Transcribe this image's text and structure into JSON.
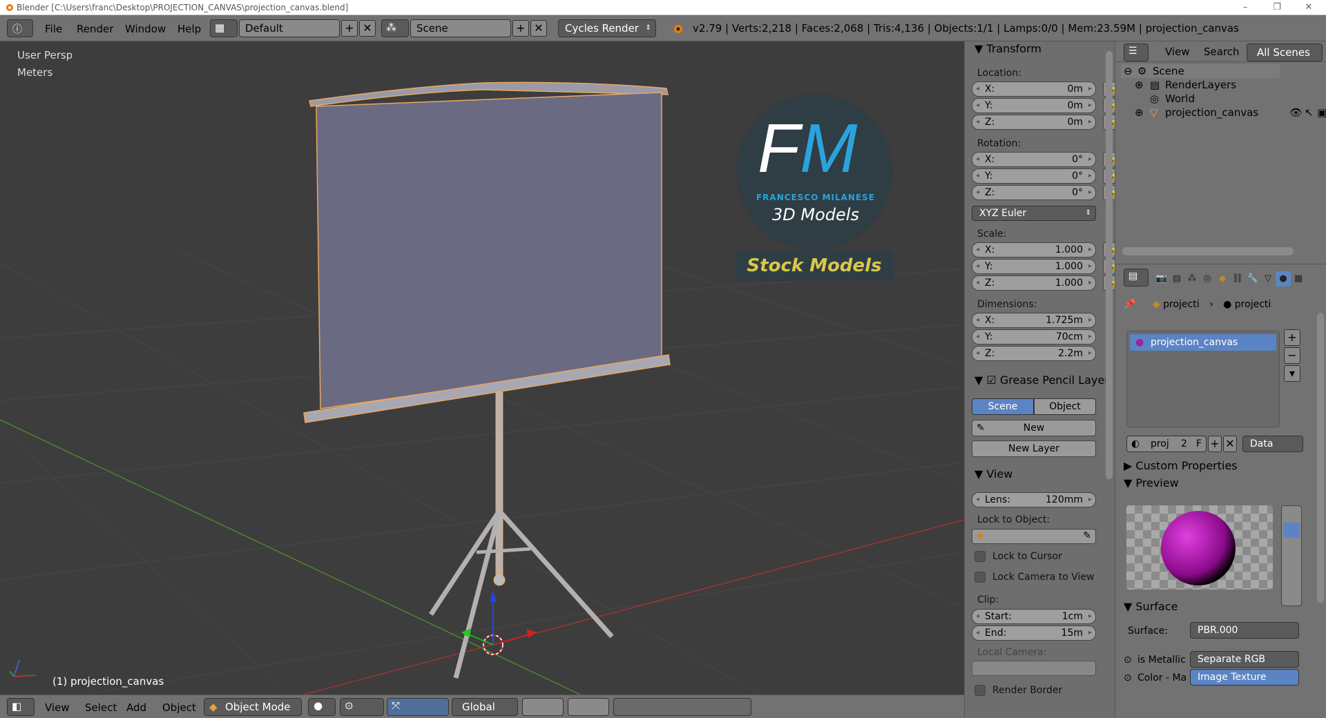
{
  "window": {
    "title": "Blender [C:\\Users\\franc\\Desktop\\PROJECTION_CANVAS\\projection_canvas.blend]",
    "minimize": "–",
    "maximize": "❐",
    "close": "✕"
  },
  "header": {
    "menus": [
      "File",
      "Render",
      "Window",
      "Help"
    ],
    "layout_name": "Default",
    "scene_name": "Scene",
    "render_engine": "Cycles Render",
    "stats": "v2.79 | Verts:2,218 | Faces:2,068 | Tris:4,136 | Objects:1/1 | Lamps:0/0 | Mem:23.59M | projection_canvas"
  },
  "viewport": {
    "view_name": "User Persp",
    "units": "Meters",
    "selected_object": "(1) projection_canvas",
    "watermark": {
      "logo_letters": "FM",
      "author": "FRANCESCO MILANESE",
      "subtitle": "3D Models",
      "banner": "Stock Models"
    }
  },
  "bottombar": {
    "menus": [
      "View",
      "Select",
      "Add",
      "Object"
    ],
    "mode": "Object Mode",
    "orientation": "Global"
  },
  "npanel": {
    "transform_title": "Transform",
    "location_label": "Location:",
    "location": [
      {
        "k": "X:",
        "v": "0m"
      },
      {
        "k": "Y:",
        "v": "0m"
      },
      {
        "k": "Z:",
        "v": "0m"
      }
    ],
    "rotation_label": "Rotation:",
    "rotation": [
      {
        "k": "X:",
        "v": "0°"
      },
      {
        "k": "Y:",
        "v": "0°"
      },
      {
        "k": "Z:",
        "v": "0°"
      }
    ],
    "rotation_mode": "XYZ Euler",
    "scale_label": "Scale:",
    "scale": [
      {
        "k": "X:",
        "v": "1.000"
      },
      {
        "k": "Y:",
        "v": "1.000"
      },
      {
        "k": "Z:",
        "v": "1.000"
      }
    ],
    "dimensions_label": "Dimensions:",
    "dimensions": [
      {
        "k": "X:",
        "v": "1.725m"
      },
      {
        "k": "Y:",
        "v": "70cm"
      },
      {
        "k": "Z:",
        "v": "2.2m"
      }
    ],
    "grease_title": "Grease Pencil Layer",
    "grease_tabs": [
      "Scene",
      "Object"
    ],
    "grease_new": "New",
    "grease_new_layer": "New Layer",
    "view_title": "View",
    "lens_label": "Lens:",
    "lens_value": "120mm",
    "lock_object_label": "Lock to Object:",
    "lock_cursor": "Lock to Cursor",
    "lock_camera": "Lock Camera to View",
    "clip_label": "Clip:",
    "clip_start_label": "Start:",
    "clip_start": "1cm",
    "clip_end_label": "End:",
    "clip_end": "15m",
    "local_camera_label": "Local Camera:",
    "render_border": "Render Border"
  },
  "outliner": {
    "view_menu": "View",
    "search_menu": "Search",
    "filter": "All Scenes",
    "items": [
      "Scene",
      "RenderLayers",
      "World",
      "projection_canvas"
    ]
  },
  "properties": {
    "breadcrumb": [
      "projecti",
      "projecti"
    ],
    "material_slot": "projection_canvas",
    "material_name": "proj",
    "users": "2",
    "fake_user": "F",
    "link": "Data",
    "custom_props": "Custom Properties",
    "preview": "Preview",
    "surface": "Surface",
    "surface_label": "Surface:",
    "surface_value": "PBR.000",
    "metallic_label": "is Metallic",
    "metallic_value": "Separate RGB",
    "color_label": "Color - Ma",
    "color_value": "Image Texture"
  }
}
